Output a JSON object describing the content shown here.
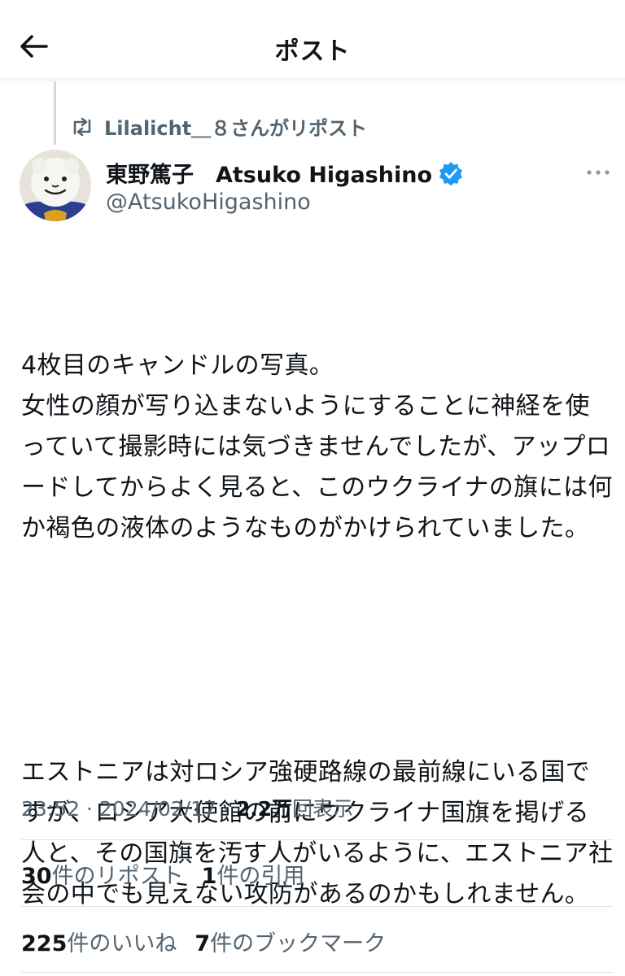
{
  "header": {
    "title": "ポスト",
    "back_icon": "arrow-left-icon"
  },
  "repost": {
    "text": "Lilalicht＿８さんがリポスト",
    "icon": "repost-icon"
  },
  "author": {
    "name": "東野篤子　Atsuko Higashino",
    "handle": "@AtsukoHigashino",
    "verified_icon": "verified-badge-icon",
    "verified_color": "#1d9bf0",
    "more_icon": "more-horizontal-icon"
  },
  "post": {
    "paragraphs": [
      "4枚目のキャンドルの写真。\n女性の顔が写り込まないようにすることに神経を使っていて撮影時には気づきませんでしたが、アップロードしてからよく見ると、このウクライナの旗には何か褐色の液体のようなものがかけられていました。",
      "エストニアは対ロシア強硬路線の最前線にいる国ですが、ロシア大使館の前にウクライナ国旗を掲げる人と、その国旗を汚す人がいるように、エストニア社会の中でも見えない攻防があるのかもしれません。"
    ]
  },
  "meta": {
    "time": "23:52",
    "sep1": " · ",
    "date": "2024/02/17",
    "sep2": " · ",
    "views_num": "2.2万",
    "views_label": "回表示"
  },
  "stats": {
    "reposts_num": "30",
    "reposts_label": "件のリポスト",
    "quotes_num": "1",
    "quotes_label": "件の引用",
    "likes_num": "225",
    "likes_label": "件のいいね",
    "bookmarks_num": "7",
    "bookmarks_label": "件のブックマーク"
  },
  "colors": {
    "text_primary": "#0f1419",
    "text_secondary": "#536471",
    "accent": "#1d9bf0"
  }
}
